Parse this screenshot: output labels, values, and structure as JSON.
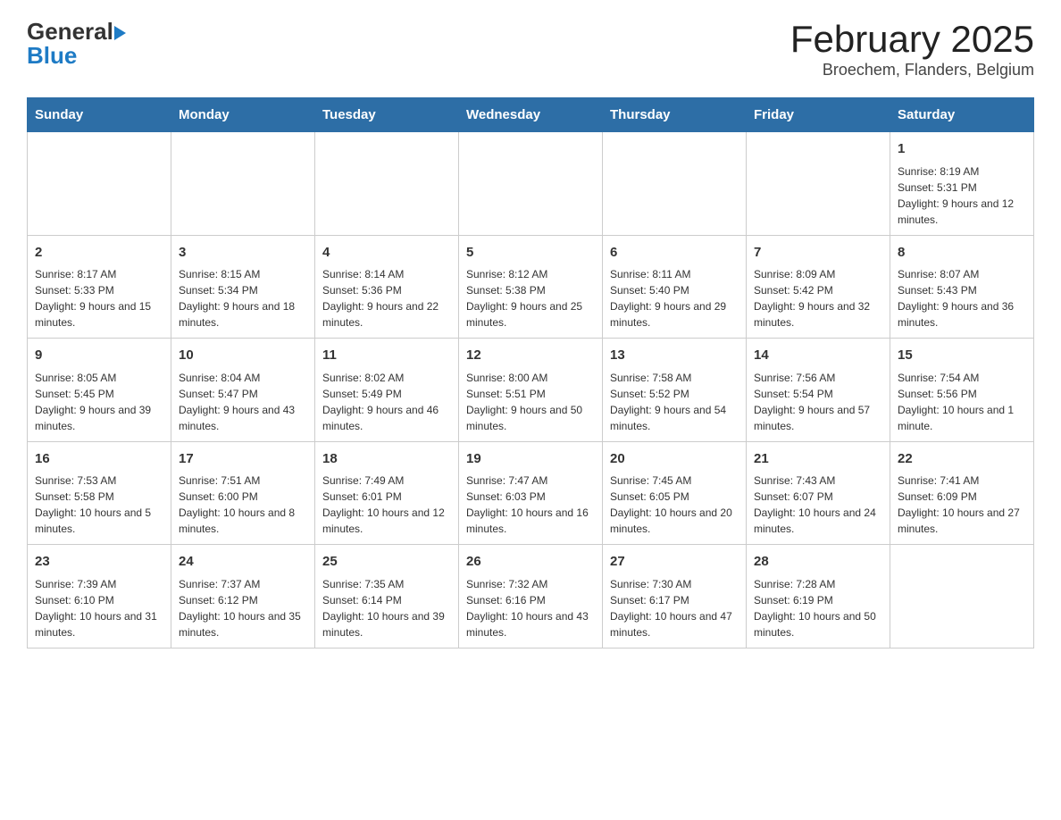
{
  "header": {
    "logo_general": "General",
    "logo_blue": "Blue",
    "month_title": "February 2025",
    "location": "Broechem, Flanders, Belgium"
  },
  "days_of_week": [
    "Sunday",
    "Monday",
    "Tuesday",
    "Wednesday",
    "Thursday",
    "Friday",
    "Saturday"
  ],
  "weeks": [
    [
      {
        "day": "",
        "info": ""
      },
      {
        "day": "",
        "info": ""
      },
      {
        "day": "",
        "info": ""
      },
      {
        "day": "",
        "info": ""
      },
      {
        "day": "",
        "info": ""
      },
      {
        "day": "",
        "info": ""
      },
      {
        "day": "1",
        "info": "Sunrise: 8:19 AM\nSunset: 5:31 PM\nDaylight: 9 hours and 12 minutes."
      }
    ],
    [
      {
        "day": "2",
        "info": "Sunrise: 8:17 AM\nSunset: 5:33 PM\nDaylight: 9 hours and 15 minutes."
      },
      {
        "day": "3",
        "info": "Sunrise: 8:15 AM\nSunset: 5:34 PM\nDaylight: 9 hours and 18 minutes."
      },
      {
        "day": "4",
        "info": "Sunrise: 8:14 AM\nSunset: 5:36 PM\nDaylight: 9 hours and 22 minutes."
      },
      {
        "day": "5",
        "info": "Sunrise: 8:12 AM\nSunset: 5:38 PM\nDaylight: 9 hours and 25 minutes."
      },
      {
        "day": "6",
        "info": "Sunrise: 8:11 AM\nSunset: 5:40 PM\nDaylight: 9 hours and 29 minutes."
      },
      {
        "day": "7",
        "info": "Sunrise: 8:09 AM\nSunset: 5:42 PM\nDaylight: 9 hours and 32 minutes."
      },
      {
        "day": "8",
        "info": "Sunrise: 8:07 AM\nSunset: 5:43 PM\nDaylight: 9 hours and 36 minutes."
      }
    ],
    [
      {
        "day": "9",
        "info": "Sunrise: 8:05 AM\nSunset: 5:45 PM\nDaylight: 9 hours and 39 minutes."
      },
      {
        "day": "10",
        "info": "Sunrise: 8:04 AM\nSunset: 5:47 PM\nDaylight: 9 hours and 43 minutes."
      },
      {
        "day": "11",
        "info": "Sunrise: 8:02 AM\nSunset: 5:49 PM\nDaylight: 9 hours and 46 minutes."
      },
      {
        "day": "12",
        "info": "Sunrise: 8:00 AM\nSunset: 5:51 PM\nDaylight: 9 hours and 50 minutes."
      },
      {
        "day": "13",
        "info": "Sunrise: 7:58 AM\nSunset: 5:52 PM\nDaylight: 9 hours and 54 minutes."
      },
      {
        "day": "14",
        "info": "Sunrise: 7:56 AM\nSunset: 5:54 PM\nDaylight: 9 hours and 57 minutes."
      },
      {
        "day": "15",
        "info": "Sunrise: 7:54 AM\nSunset: 5:56 PM\nDaylight: 10 hours and 1 minute."
      }
    ],
    [
      {
        "day": "16",
        "info": "Sunrise: 7:53 AM\nSunset: 5:58 PM\nDaylight: 10 hours and 5 minutes."
      },
      {
        "day": "17",
        "info": "Sunrise: 7:51 AM\nSunset: 6:00 PM\nDaylight: 10 hours and 8 minutes."
      },
      {
        "day": "18",
        "info": "Sunrise: 7:49 AM\nSunset: 6:01 PM\nDaylight: 10 hours and 12 minutes."
      },
      {
        "day": "19",
        "info": "Sunrise: 7:47 AM\nSunset: 6:03 PM\nDaylight: 10 hours and 16 minutes."
      },
      {
        "day": "20",
        "info": "Sunrise: 7:45 AM\nSunset: 6:05 PM\nDaylight: 10 hours and 20 minutes."
      },
      {
        "day": "21",
        "info": "Sunrise: 7:43 AM\nSunset: 6:07 PM\nDaylight: 10 hours and 24 minutes."
      },
      {
        "day": "22",
        "info": "Sunrise: 7:41 AM\nSunset: 6:09 PM\nDaylight: 10 hours and 27 minutes."
      }
    ],
    [
      {
        "day": "23",
        "info": "Sunrise: 7:39 AM\nSunset: 6:10 PM\nDaylight: 10 hours and 31 minutes."
      },
      {
        "day": "24",
        "info": "Sunrise: 7:37 AM\nSunset: 6:12 PM\nDaylight: 10 hours and 35 minutes."
      },
      {
        "day": "25",
        "info": "Sunrise: 7:35 AM\nSunset: 6:14 PM\nDaylight: 10 hours and 39 minutes."
      },
      {
        "day": "26",
        "info": "Sunrise: 7:32 AM\nSunset: 6:16 PM\nDaylight: 10 hours and 43 minutes."
      },
      {
        "day": "27",
        "info": "Sunrise: 7:30 AM\nSunset: 6:17 PM\nDaylight: 10 hours and 47 minutes."
      },
      {
        "day": "28",
        "info": "Sunrise: 7:28 AM\nSunset: 6:19 PM\nDaylight: 10 hours and 50 minutes."
      },
      {
        "day": "",
        "info": ""
      }
    ]
  ]
}
